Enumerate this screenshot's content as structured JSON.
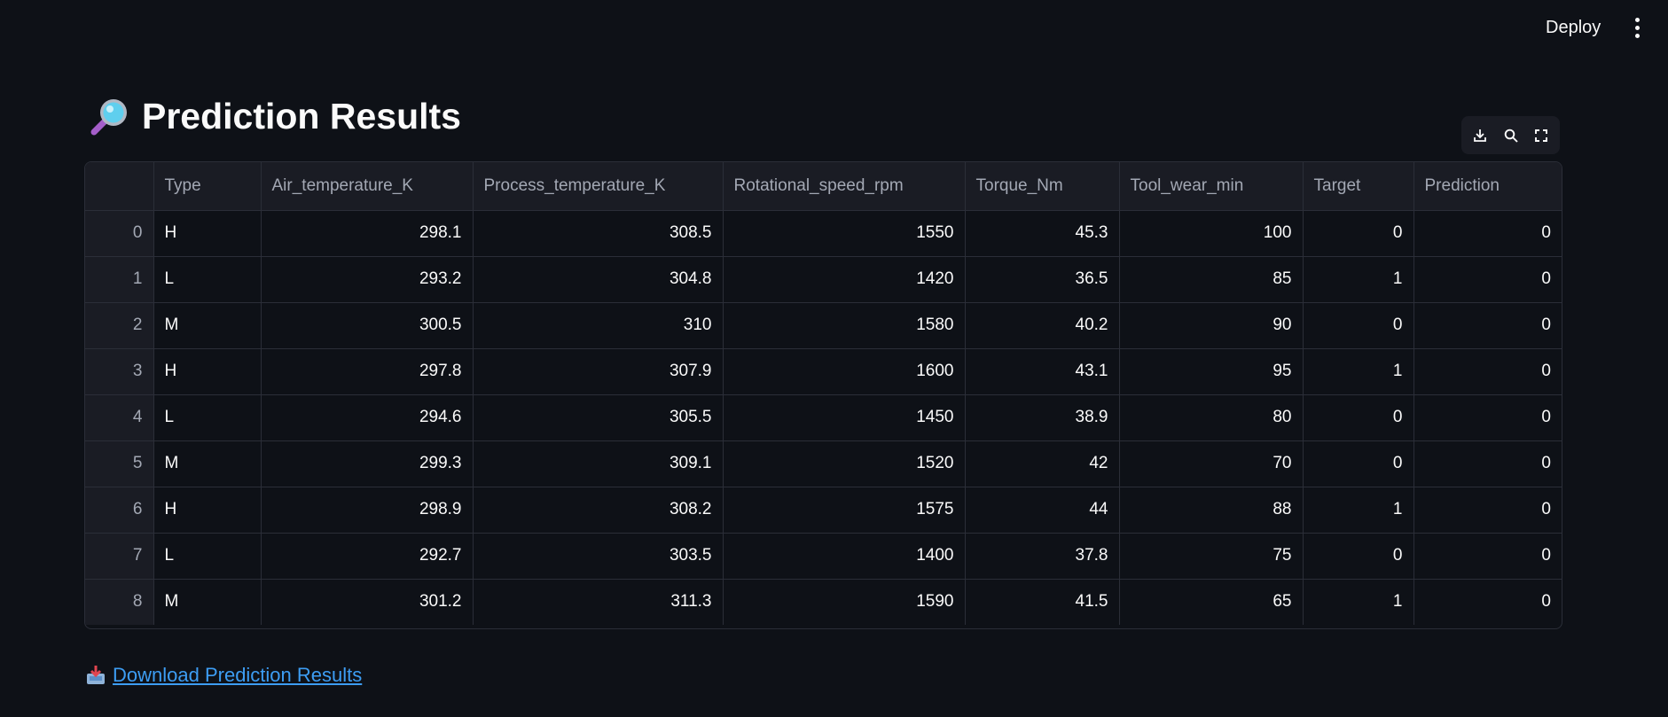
{
  "header": {
    "deploy_label": "Deploy",
    "menu_icon": "kebab-menu-icon"
  },
  "title": {
    "icon": "magnifying-glass-icon",
    "text": "Prediction Results"
  },
  "toolbar": {
    "icons": [
      "download-icon",
      "search-icon",
      "fullscreen-icon"
    ]
  },
  "table": {
    "columns": [
      "",
      "Type",
      "Air_temperature_K",
      "Process_temperature_K",
      "Rotational_speed_rpm",
      "Torque_Nm",
      "Tool_wear_min",
      "Target",
      "Prediction"
    ],
    "rows": [
      [
        "0",
        "H",
        "298.1",
        "308.5",
        "1550",
        "45.3",
        "100",
        "0",
        "0"
      ],
      [
        "1",
        "L",
        "293.2",
        "304.8",
        "1420",
        "36.5",
        "85",
        "1",
        "0"
      ],
      [
        "2",
        "M",
        "300.5",
        "310",
        "1580",
        "40.2",
        "90",
        "0",
        "0"
      ],
      [
        "3",
        "H",
        "297.8",
        "307.9",
        "1600",
        "43.1",
        "95",
        "1",
        "0"
      ],
      [
        "4",
        "L",
        "294.6",
        "305.5",
        "1450",
        "38.9",
        "80",
        "0",
        "0"
      ],
      [
        "5",
        "M",
        "299.3",
        "309.1",
        "1520",
        "42",
        "70",
        "0",
        "0"
      ],
      [
        "6",
        "H",
        "298.9",
        "308.2",
        "1575",
        "44",
        "88",
        "1",
        "0"
      ],
      [
        "7",
        "L",
        "292.7",
        "303.5",
        "1400",
        "37.8",
        "75",
        "0",
        "0"
      ],
      [
        "8",
        "M",
        "301.2",
        "311.3",
        "1590",
        "41.5",
        "65",
        "1",
        "0"
      ]
    ]
  },
  "download_link": {
    "icon": "inbox-tray-icon",
    "label": "Download Prediction Results"
  },
  "colors": {
    "background": "#0e1117",
    "header_bg": "#1a1c24",
    "border": "#2b2e38",
    "link": "#3d9df3"
  }
}
